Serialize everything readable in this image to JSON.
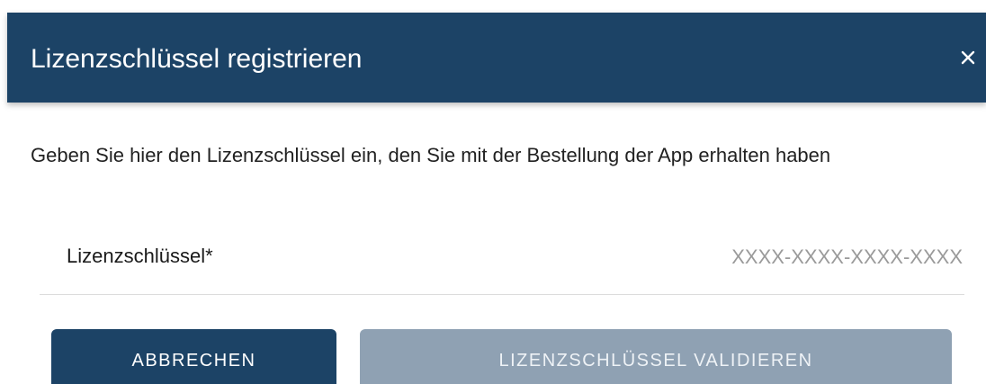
{
  "dialog": {
    "title": "Lizenzschlüssel registrieren",
    "close_icon": "close-icon",
    "close_symbol": "×",
    "instructions": "Geben Sie hier den Lizenzschlüssel ein, den Sie mit der Bestellung der App erhalten haben",
    "license_field": {
      "label": "Lizenzschlüssel*",
      "value": "",
      "placeholder": "XXXX-XXXX-XXXX-XXXX"
    },
    "buttons": {
      "cancel_label": "ABBRECHEN",
      "validate_label": "LIZENZSCHLÜSSEL VALIDIEREN",
      "validate_enabled": false
    }
  },
  "colors": {
    "header_bg": "#1c4366",
    "primary_button": "#1c4366",
    "disabled_button": "#8fa1b3",
    "placeholder_text": "#9a9a9a"
  }
}
